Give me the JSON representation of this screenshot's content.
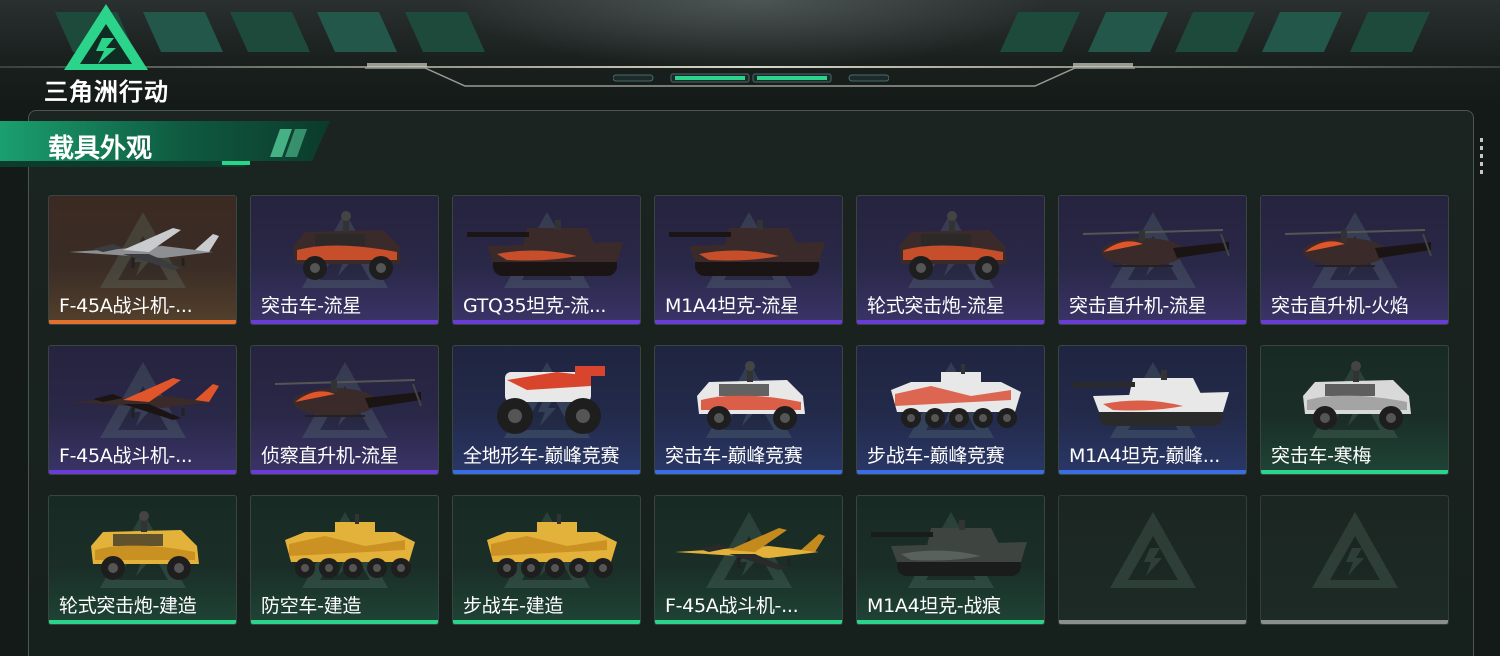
{
  "app": {
    "logo_text": "三角洲行动",
    "section_title": "载具外观"
  },
  "colors": {
    "accent_green": "#2bd48a",
    "rarity_purple": "#6a3cd6",
    "rarity_orange": "#e0702c",
    "rarity_blue": "#3a6ee0",
    "rarity_green": "#2bd48a",
    "empty": "#8a8f8e"
  },
  "skins": [
    {
      "label": "F-45A战斗机-...",
      "rarity": "orange",
      "vehicle": "jet-icon",
      "paint": "silver"
    },
    {
      "label": "突击车-流星",
      "rarity": "purple",
      "vehicle": "armored-car-icon",
      "paint": "fire"
    },
    {
      "label": "GTQ35坦克-流...",
      "rarity": "purple",
      "vehicle": "tank-icon",
      "paint": "fire"
    },
    {
      "label": "M1A4坦克-流星",
      "rarity": "purple",
      "vehicle": "tank-icon",
      "paint": "fire"
    },
    {
      "label": "轮式突击炮-流星",
      "rarity": "purple",
      "vehicle": "armored-car-icon",
      "paint": "fire"
    },
    {
      "label": "突击直升机-流星",
      "rarity": "purple",
      "vehicle": "helicopter-icon",
      "paint": "fire"
    },
    {
      "label": "突击直升机-火焰",
      "rarity": "purple",
      "vehicle": "helicopter-icon",
      "paint": "fire"
    },
    {
      "label": "F-45A战斗机-...",
      "rarity": "purple",
      "vehicle": "jet-icon",
      "paint": "fire"
    },
    {
      "label": "侦察直升机-流星",
      "rarity": "purple",
      "vehicle": "helicopter-icon",
      "paint": "fire"
    },
    {
      "label": "全地形车-巅峰竞赛",
      "rarity": "blue",
      "vehicle": "atv-icon",
      "paint": "race"
    },
    {
      "label": "突击车-巅峰竞赛",
      "rarity": "blue",
      "vehicle": "armored-car-icon",
      "paint": "race"
    },
    {
      "label": "步战车-巅峰竞赛",
      "rarity": "blue",
      "vehicle": "ifv-icon",
      "paint": "race"
    },
    {
      "label": "M1A4坦克-巅峰...",
      "rarity": "blue",
      "vehicle": "tank-icon",
      "paint": "race"
    },
    {
      "label": "突击车-寒梅",
      "rarity": "green",
      "vehicle": "armored-car-icon",
      "paint": "white"
    },
    {
      "label": "轮式突击炮-建造",
      "rarity": "green",
      "vehicle": "armored-car-icon",
      "paint": "yellow"
    },
    {
      "label": "防空车-建造",
      "rarity": "green",
      "vehicle": "ifv-icon",
      "paint": "yellow"
    },
    {
      "label": "步战车-建造",
      "rarity": "green",
      "vehicle": "ifv-icon",
      "paint": "yellow"
    },
    {
      "label": "F-45A战斗机-...",
      "rarity": "green",
      "vehicle": "jet-icon",
      "paint": "yellow"
    },
    {
      "label": "M1A4坦克-战痕",
      "rarity": "green",
      "vehicle": "tank-icon",
      "paint": "dark"
    },
    {
      "label": "",
      "rarity": "empty",
      "vehicle": "",
      "paint": ""
    },
    {
      "label": "",
      "rarity": "empty",
      "vehicle": "",
      "paint": ""
    }
  ]
}
